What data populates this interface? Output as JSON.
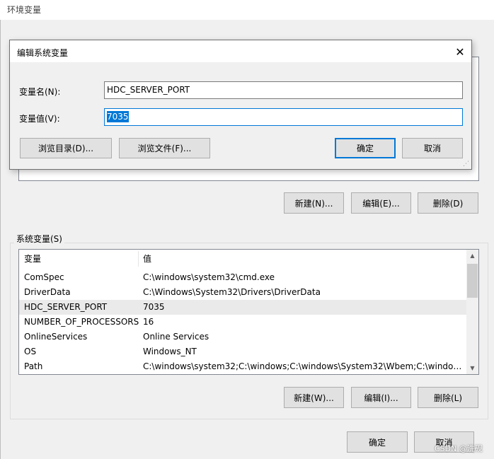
{
  "outer_window": {
    "title": "环境变量"
  },
  "user_vars": {
    "buttons": {
      "new": "新建(N)...",
      "edit": "编辑(E)...",
      "delete": "删除(D)"
    }
  },
  "system_vars": {
    "group_label": "系统变量(S)",
    "columns": [
      "变量",
      "值"
    ],
    "rows": [
      {
        "name": "ComSpec",
        "value": "C:\\windows\\system32\\cmd.exe"
      },
      {
        "name": "DriverData",
        "value": "C:\\Windows\\System32\\Drivers\\DriverData"
      },
      {
        "name": "HDC_SERVER_PORT",
        "value": "7035"
      },
      {
        "name": "NUMBER_OF_PROCESSORS",
        "value": "16"
      },
      {
        "name": "OnlineServices",
        "value": "Online Services"
      },
      {
        "name": "OS",
        "value": "Windows_NT"
      },
      {
        "name": "Path",
        "value": "C:\\windows\\system32;C:\\windows;C:\\windows\\System32\\Wbem;C:\\windows\\..."
      }
    ],
    "selected_row": 2,
    "buttons": {
      "new": "新建(W)...",
      "edit": "编辑(I)...",
      "delete": "删除(L)"
    }
  },
  "footer": {
    "ok": "确定",
    "cancel": "取消"
  },
  "dialog": {
    "title": "编辑系统变量",
    "name_label": "变量名(N):",
    "name_value": "HDC_SERVER_PORT",
    "value_label": "变量值(V):",
    "value_value": "7035",
    "browse_dir": "浏览目录(D)...",
    "browse_file": "浏览文件(F)...",
    "ok": "确定",
    "cancel": "取消",
    "close_icon": "close-icon"
  },
  "watermark": "CSDN @洗砚",
  "colors": {
    "accent": "#0078d7",
    "selection": "#0078d7"
  }
}
